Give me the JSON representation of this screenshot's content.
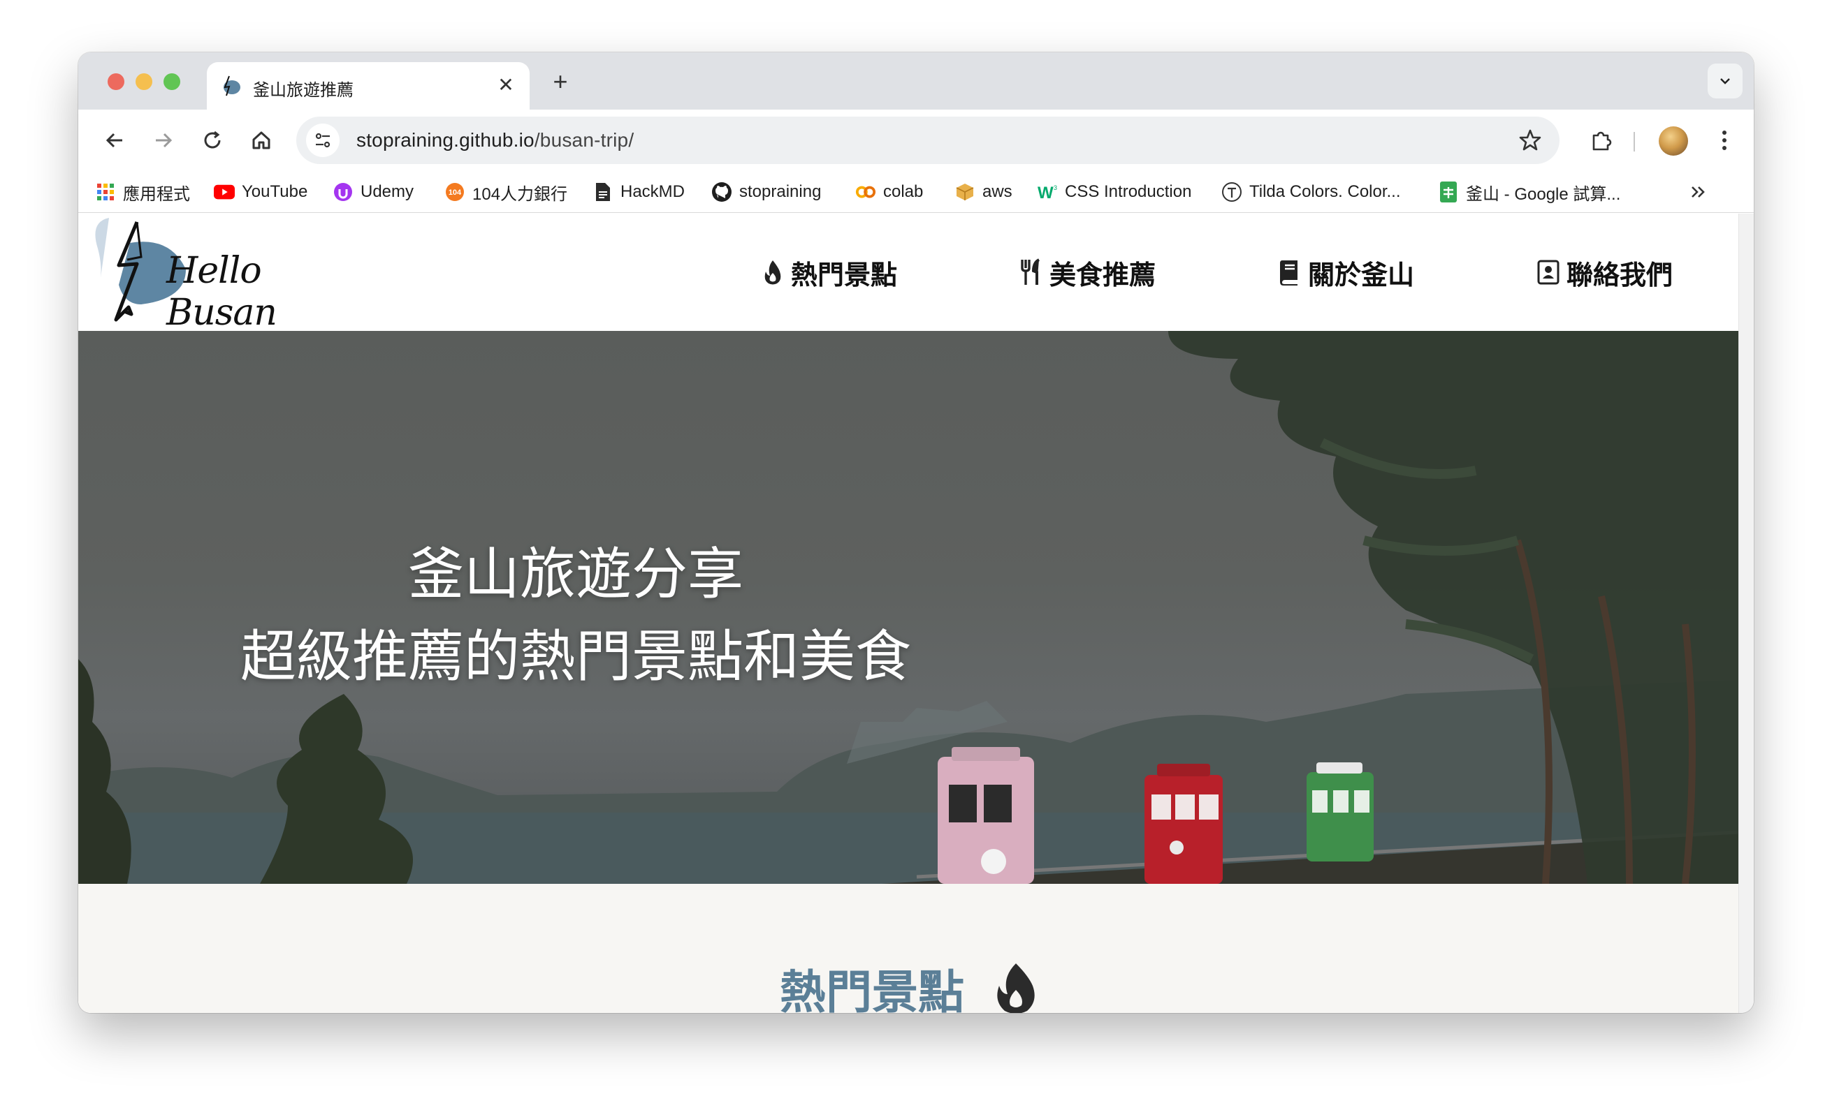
{
  "browser": {
    "tab_title": "釜山旅遊推薦",
    "url_host": "stopraining.github.io",
    "url_path": "/busan-trip/"
  },
  "bookmarks": [
    {
      "label": "應用程式",
      "icon": "apps-grid-icon"
    },
    {
      "label": "YouTube",
      "icon": "youtube-icon"
    },
    {
      "label": "Udemy",
      "icon": "udemy-icon"
    },
    {
      "label": "104人力銀行",
      "icon": "104-icon"
    },
    {
      "label": "HackMD",
      "icon": "document-icon"
    },
    {
      "label": "stopraining",
      "icon": "github-icon"
    },
    {
      "label": "colab",
      "icon": "colab-icon"
    },
    {
      "label": "aws",
      "icon": "aws-box-icon"
    },
    {
      "label": "CSS Introduction",
      "icon": "w3schools-icon"
    },
    {
      "label": "Tilda Colors. Color...",
      "icon": "tilda-icon"
    },
    {
      "label": "釜山 - Google 試算...",
      "icon": "google-sheets-icon"
    }
  ],
  "site": {
    "logo_text": "Hello Busan",
    "nav": [
      {
        "label": "熱門景點",
        "icon": "fire-icon"
      },
      {
        "label": "美食推薦",
        "icon": "utensils-icon"
      },
      {
        "label": "關於釜山",
        "icon": "book-icon"
      },
      {
        "label": "聯絡我們",
        "icon": "contact-card-icon"
      }
    ],
    "hero_line1": "釜山旅遊分享",
    "hero_line2": "超級推薦的熱門景點和美食",
    "section_title": "熱門景點"
  },
  "colors": {
    "accent": "#5b7f97",
    "logo_blob": "#5e86a3"
  }
}
